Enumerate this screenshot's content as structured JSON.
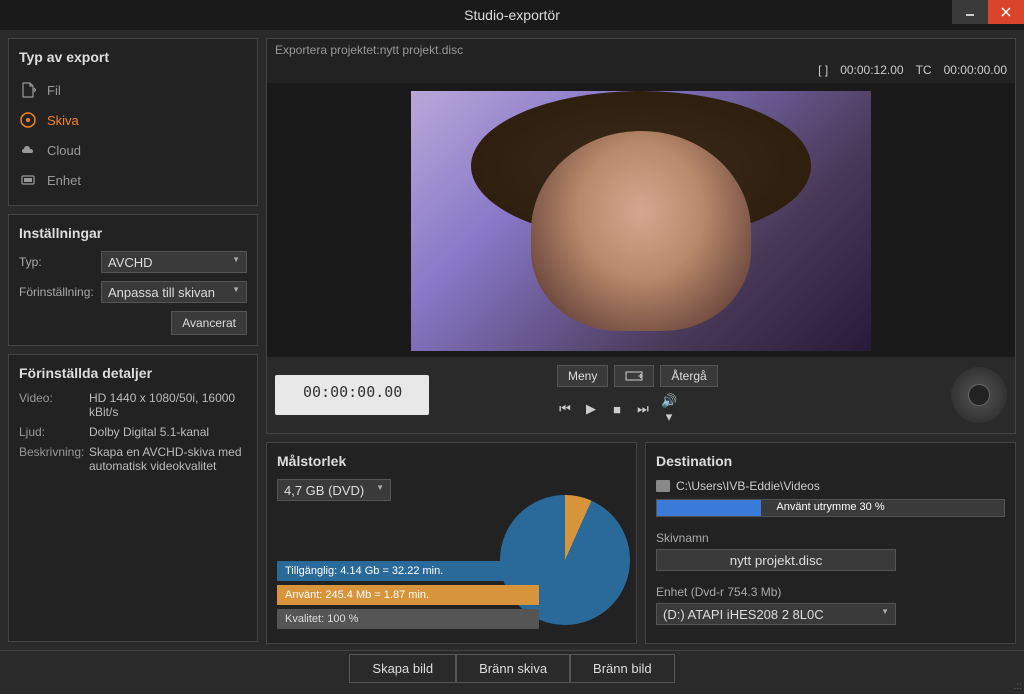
{
  "window": {
    "title": "Studio-exportör"
  },
  "export_types": {
    "header": "Typ av export",
    "items": [
      {
        "label": "Fil",
        "icon": "file"
      },
      {
        "label": "Skiva",
        "icon": "disc",
        "active": true
      },
      {
        "label": "Cloud",
        "icon": "cloud"
      },
      {
        "label": "Enhet",
        "icon": "device"
      }
    ]
  },
  "settings": {
    "header": "Inställningar",
    "type_label": "Typ:",
    "type_value": "AVCHD",
    "preset_label": "Förinställning:",
    "preset_value": "Anpassa till skivan",
    "advanced_btn": "Avancerat"
  },
  "details": {
    "header": "Förinställda detaljer",
    "video_label": "Video:",
    "video_value": "HD 1440 x 1080/50i, 16000 kBit/s",
    "audio_label": "Ljud:",
    "audio_value": "Dolby Digital 5.1-kanal",
    "desc_label": "Beskrivning:",
    "desc_value": "Skapa en AVCHD-skiva med automatisk videokvalitet"
  },
  "preview": {
    "project_text": "Exportera projektet:nytt projekt.disc",
    "tc_bracket": "[ ]",
    "tc_duration": "00:00:12.00",
    "tc_label": "TC",
    "tc_current": "00:00:00.00",
    "timecode": "00:00:00.00",
    "menu_btn": "Meny",
    "return_btn": "Återgå"
  },
  "target": {
    "header": "Målstorlek",
    "size_value": "4,7 GB (DVD)",
    "available_label": "Tillgänglig:",
    "available_value": "4.14 Gb = 32.22 min.",
    "used_label": "Använt:",
    "used_value": "245.4 Mb = 1.87 min.",
    "quality_label": "Kvalitet:",
    "quality_value": "100 %"
  },
  "destination": {
    "header": "Destination",
    "path": "C:\\Users\\IVB-Eddie\\Videos",
    "progress_text": "Använt utrymme   30 %",
    "diskname_label": "Skivnamn",
    "diskname_value": "nytt projekt.disc",
    "device_label": "Enhet",
    "device_info": "(Dvd-r 754.3 Mb)",
    "device_value": "(D:) ATAPI   iHES208   2      8L0C"
  },
  "footer": {
    "create_btn": "Skapa bild",
    "burn_disc_btn": "Bränn skiva",
    "burn_img_btn": "Bränn bild"
  },
  "chart_data": {
    "type": "pie",
    "title": "Målstorlek",
    "series": [
      {
        "name": "Använt",
        "value": 245.4,
        "unit": "Mb",
        "minutes": 1.87,
        "color": "#d8943a"
      },
      {
        "name": "Tillgänglig",
        "value": 4.14,
        "unit": "Gb",
        "minutes": 32.22,
        "color": "#2a6a9a"
      }
    ],
    "quality_percent": 100
  }
}
